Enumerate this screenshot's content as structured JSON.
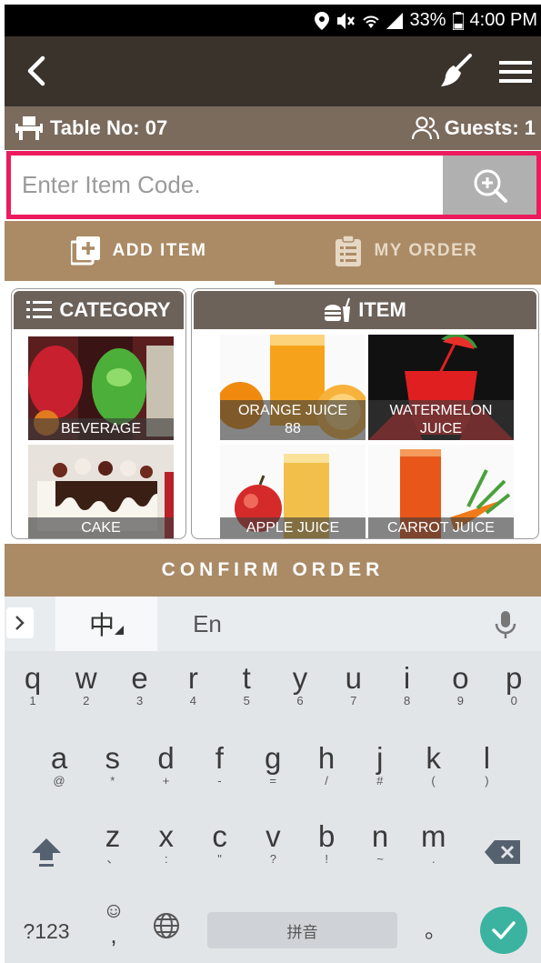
{
  "status_bar": {
    "battery": "33%",
    "time": "4:00 PM",
    "icons": [
      "location-icon",
      "mute-icon",
      "wifi-icon",
      "signal-icon",
      "battery-icon"
    ]
  },
  "app_bar": {
    "icons": [
      "back-arrow-icon",
      "broom-icon",
      "hamburger-menu-icon"
    ]
  },
  "table_info": {
    "table_label": "Table No: 07",
    "guests_label": "Guests: 1"
  },
  "search": {
    "placeholder": "Enter Item Code."
  },
  "tabs": [
    {
      "label": "ADD ITEM",
      "active": true
    },
    {
      "label": "MY ORDER",
      "active": false
    }
  ],
  "category_panel": {
    "title": "CATEGORY",
    "items": [
      {
        "label": "BEVERAGE"
      },
      {
        "label": "CAKE"
      }
    ]
  },
  "item_panel": {
    "title": "ITEM",
    "items": [
      {
        "name": "ORANGE JUICE",
        "price": "88"
      },
      {
        "name": "WATERMELON JUICE",
        "price": ""
      },
      {
        "name": "APPLE JUICE",
        "price": ""
      },
      {
        "name": "CARROT JUICE",
        "price": ""
      }
    ]
  },
  "confirm_button": "CONFIRM ORDER",
  "colors": {
    "app_bar": "#3a332c",
    "info_bar": "#7a6b5d",
    "accent_tan": "#ab8b66",
    "search_border": "#ec1b5e",
    "panel_header": "#6c6259",
    "enter_key": "#3bb3a0"
  },
  "keyboard": {
    "lang_zh": "中",
    "lang_en": "En",
    "row1": [
      {
        "k": "q",
        "s": "1"
      },
      {
        "k": "w",
        "s": "2"
      },
      {
        "k": "e",
        "s": "3"
      },
      {
        "k": "r",
        "s": "4"
      },
      {
        "k": "t",
        "s": "5"
      },
      {
        "k": "y",
        "s": "6"
      },
      {
        "k": "u",
        "s": "7"
      },
      {
        "k": "i",
        "s": "8"
      },
      {
        "k": "o",
        "s": "9"
      },
      {
        "k": "p",
        "s": "0"
      }
    ],
    "row2": [
      {
        "k": "a",
        "s": "@"
      },
      {
        "k": "s",
        "s": "*"
      },
      {
        "k": "d",
        "s": "+"
      },
      {
        "k": "f",
        "s": "-"
      },
      {
        "k": "g",
        "s": "="
      },
      {
        "k": "h",
        "s": "/"
      },
      {
        "k": "j",
        "s": "#"
      },
      {
        "k": "k",
        "s": "("
      },
      {
        "k": "l",
        "s": ")"
      }
    ],
    "row3": [
      {
        "k": "z",
        "s": "、"
      },
      {
        "k": "x",
        "s": ":"
      },
      {
        "k": "c",
        "s": "\""
      },
      {
        "k": "v",
        "s": "?"
      },
      {
        "k": "b",
        "s": "!"
      },
      {
        "k": "n",
        "s": "~"
      },
      {
        "k": "m",
        "s": "."
      }
    ],
    "symbols_key": "?123",
    "comma_key": ",",
    "space_label": "拼音",
    "period_key": "。"
  }
}
